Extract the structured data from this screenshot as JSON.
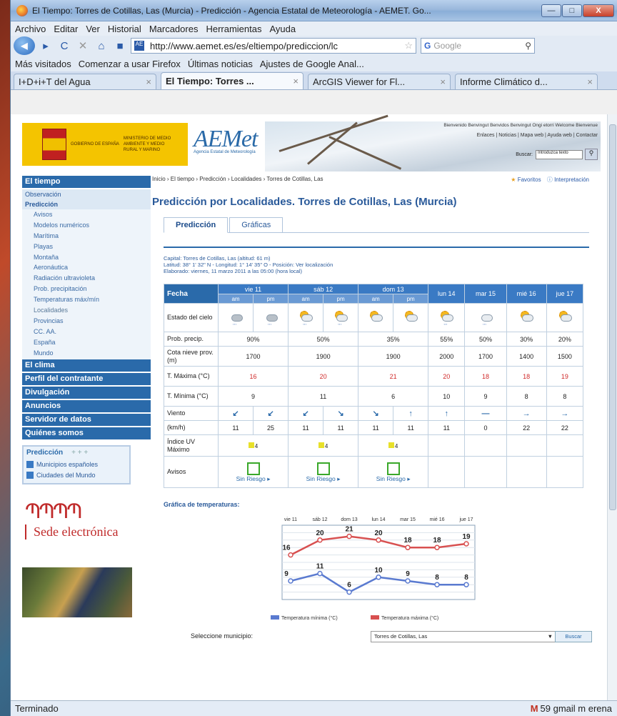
{
  "window": {
    "title": "El Tiempo: Torres de Cotillas, Las (Murcia) - Predicción - Agencia Estatal de Meteorología - AEMET. Go...",
    "min": "—",
    "max": "□",
    "close": "X"
  },
  "menu": [
    "Archivo",
    "Editar",
    "Ver",
    "Historial",
    "Marcadores",
    "Herramientas",
    "Ayuda"
  ],
  "nav": {
    "url": "http://www.aemet.es/es/eltiempo/prediccion/lc",
    "search_placeholder": "Google"
  },
  "bookmarks": [
    "Más visitados",
    "Comenzar a usar Firefox",
    "Últimas noticias",
    "Ajustes de Google Anal..."
  ],
  "tabs": [
    {
      "label": "I+D+i+T del Agua"
    },
    {
      "label": "El Tiempo: Torres ..."
    },
    {
      "label": "ArcGIS Viewer for Fl..."
    },
    {
      "label": "Informe Climático d..."
    }
  ],
  "status": {
    "left": "Terminado",
    "right": "59 gmail m erena"
  },
  "header": {
    "gov_text": "GOBIERNO DE ESPAÑA",
    "ministry_text": "MINISTERIO DE MEDIO AMBIENTE Y MEDIO RURAL Y MARINO",
    "logo": "AEMet",
    "logo_sub": "Agencia Estatal de Meteorología",
    "welcome": "Bienvenido Benvingut Benvidos Benvingut Ongi etorri Welcome Bienvenue",
    "topnav": "Enlaces | Noticias | Mapa web | Ayuda web | Contactar",
    "buscar": "Buscar:",
    "buscar_placeholder": "Introduzca texto"
  },
  "sidebar": {
    "eltiempo": "El tiempo",
    "observacion": "Observación",
    "prediccion": "Predicción",
    "items": [
      "Avisos",
      "Modelos numéricos",
      "Marítima",
      "Playas",
      "Montaña",
      "Aeronáutica",
      "Radiación ultravioleta",
      "Prob. precipitación",
      "Temperaturas máx/mín",
      "Localidades",
      "Provincias",
      "CC. AA.",
      "España",
      "Mundo"
    ],
    "sections": [
      "El clima",
      "Perfil del contratante",
      "Divulgación",
      "Anuncios",
      "Servidor de datos",
      "Quiénes somos"
    ],
    "predbox_title": "Predicción",
    "predbox_controls": "+ + +",
    "predbox_links": [
      "Municipios españoles",
      "Ciudades del Mundo"
    ],
    "sede": "Sede electrónica"
  },
  "main": {
    "breadcrumb": "Inicio › El tiempo › Predicción › Localidades › Torres de Cotillas, Las",
    "favoritos": "Favoritos",
    "interpretacion": "Interpretación",
    "title": "Predicción por Localidades. Torres de Cotillas, Las (Murcia)",
    "tab_pred": "Predicción",
    "tab_graf": "Gráficas",
    "capital": "Capital: Torres de Cotillas, Las (altitud: 61 m)",
    "latitud": "Latitud: 38° 1' 32\" N - Longitud: 1° 14' 35\" O - Posición: Ver localización",
    "elaborado": "Elaborado: viernes, 11 marzo 2011 a las 05:00 (hora local)"
  },
  "forecast": {
    "fecha_label": "Fecha",
    "days_split": [
      "vie 11",
      "sáb 12",
      "dom 13"
    ],
    "days_single": [
      "lun 14",
      "mar 15",
      "mié 16",
      "jue 17"
    ],
    "half_labels": [
      "am",
      "pm"
    ],
    "row_labels": {
      "estado": "Estado del cielo",
      "prob": "Prob. precip.",
      "cota": "Cota nieve prov.(m)",
      "tmax": "T. Máxima (°C)",
      "tmin": "T. Mínima (°C)",
      "viento": "Viento",
      "kmh": "(km/h)",
      "uv": "Índice UV Máximo",
      "avisos": "Avisos"
    },
    "prob": [
      "90%",
      "50%",
      "35%",
      "55%",
      "50%",
      "30%",
      "20%"
    ],
    "cota": [
      "1700",
      "1900",
      "1900",
      "2000",
      "1700",
      "1400",
      "1500"
    ],
    "tmax": [
      "16",
      "20",
      "21",
      "20",
      "18",
      "18",
      "19"
    ],
    "tmin": [
      "9",
      "11",
      "6",
      "10",
      "9",
      "8",
      "8"
    ],
    "wind_dirs": [
      "↙",
      "↙",
      "↙",
      "↘",
      "↘",
      "↑",
      "↑",
      "—",
      "→",
      "→"
    ],
    "wind_speed": [
      "11",
      "25",
      "11",
      "11",
      "11",
      "11",
      "11",
      "0",
      "22",
      "22"
    ],
    "uv": [
      "4",
      "4",
      "4"
    ],
    "aviso_text": "Sin Riesgo",
    "aviso_arrow": "▸"
  },
  "grafica": {
    "title": "Gráfica de temperaturas:",
    "legend_min": "Temperatura mínima (°C)",
    "legend_max": "Temperatura máxima (°C)",
    "select_label": "Seleccione municipio:",
    "select_value": "Torres de Cotillas, Las",
    "select_button": "Buscar"
  },
  "chart_data": {
    "type": "line",
    "categories": [
      "vie 11",
      "sáb 12",
      "dom 13",
      "lun 14",
      "mar 15",
      "mié 16",
      "jue 17"
    ],
    "series": [
      {
        "name": "Temperatura máxima (°C)",
        "values": [
          16,
          20,
          21,
          20,
          18,
          18,
          19
        ],
        "color": "#d85050"
      },
      {
        "name": "Temperatura mínima (°C)",
        "values": [
          9,
          11,
          6,
          10,
          9,
          8,
          8
        ],
        "color": "#5a7ad0"
      }
    ],
    "legend": "bottom",
    "grid": true
  }
}
